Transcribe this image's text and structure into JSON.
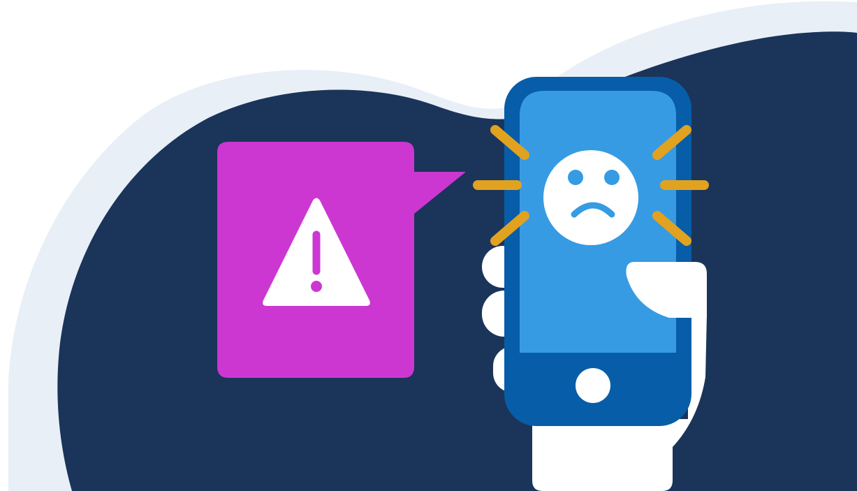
{
  "colors": {
    "background": "#ffffff",
    "blob_light": "#e8eff7",
    "blob_dark": "#1b3459",
    "speech_bubble": "#cc37d2",
    "warning_sign": "#ffffff",
    "phone_body": "#075da8",
    "phone_screen": "#369be3",
    "face": "#ffffff",
    "face_features": "#369be3",
    "alert_rays": "#e1a21f",
    "hand": "#ffffff"
  },
  "icons": {
    "bubble": "speech-bubble-icon",
    "warning": "warning-triangle-icon",
    "phone": "smartphone-icon",
    "face": "sad-face-icon",
    "rays": "alert-rays-icon",
    "hand": "hand-icon"
  }
}
